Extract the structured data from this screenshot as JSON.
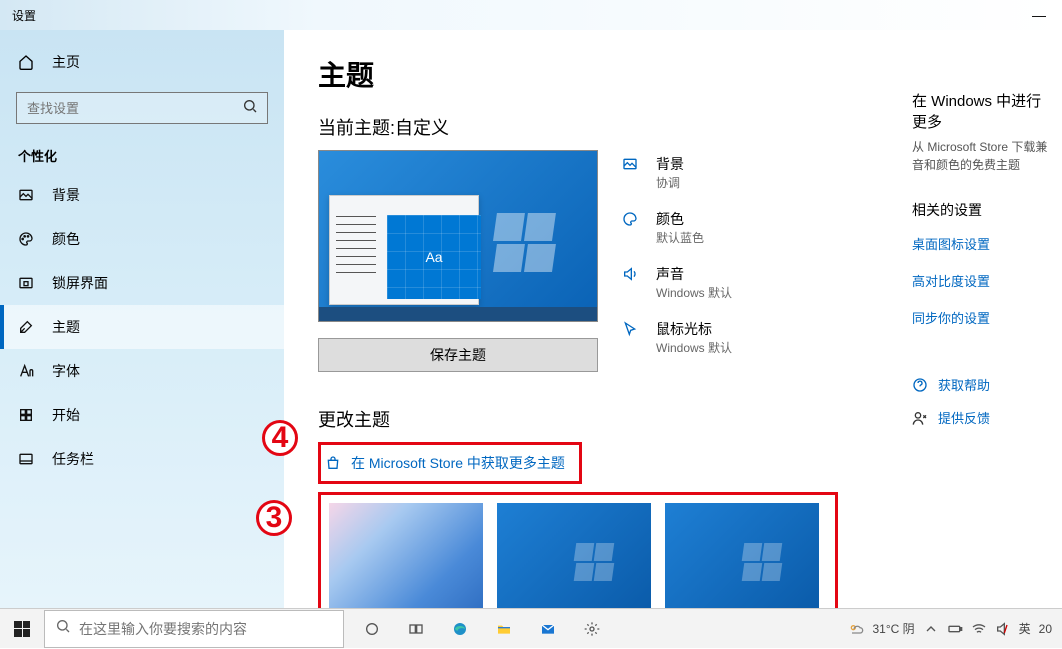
{
  "titlebar": {
    "app": "设置"
  },
  "sidebar": {
    "home": "主页",
    "search_placeholder": "查找设置",
    "category": "个性化",
    "items": [
      {
        "label": "背景"
      },
      {
        "label": "颜色"
      },
      {
        "label": "锁屏界面"
      },
      {
        "label": "主题"
      },
      {
        "label": "字体"
      },
      {
        "label": "开始"
      },
      {
        "label": "任务栏"
      }
    ]
  },
  "main": {
    "title": "主题",
    "current_label": "当前主题:自定义",
    "preview_tile_text": "Aa",
    "props": {
      "bg": {
        "t": "背景",
        "v": "协调"
      },
      "color": {
        "t": "颜色",
        "v": "默认蓝色"
      },
      "sound": {
        "t": "声音",
        "v": "Windows 默认"
      },
      "cursor": {
        "t": "鼠标光标",
        "v": "Windows 默认"
      }
    },
    "save_btn": "保存主题",
    "change_title": "更改主题",
    "store_link": "在 Microsoft Store 中获取更多主题"
  },
  "right": {
    "more_title": "在 Windows 中进行更多",
    "more_desc": "从 Microsoft Store 下载兼音和颜色的免费主题",
    "related_title": "相关的设置",
    "links": [
      "桌面图标设置",
      "高对比度设置",
      "同步你的设置"
    ],
    "help": "获取帮助",
    "feedback": "提供反馈"
  },
  "taskbar": {
    "search_placeholder": "在这里输入你要搜索的内容",
    "weather": "31°C 阴",
    "ime": "英",
    "clock_frag": "20"
  },
  "annotations": {
    "a3": "3",
    "a4": "4"
  }
}
